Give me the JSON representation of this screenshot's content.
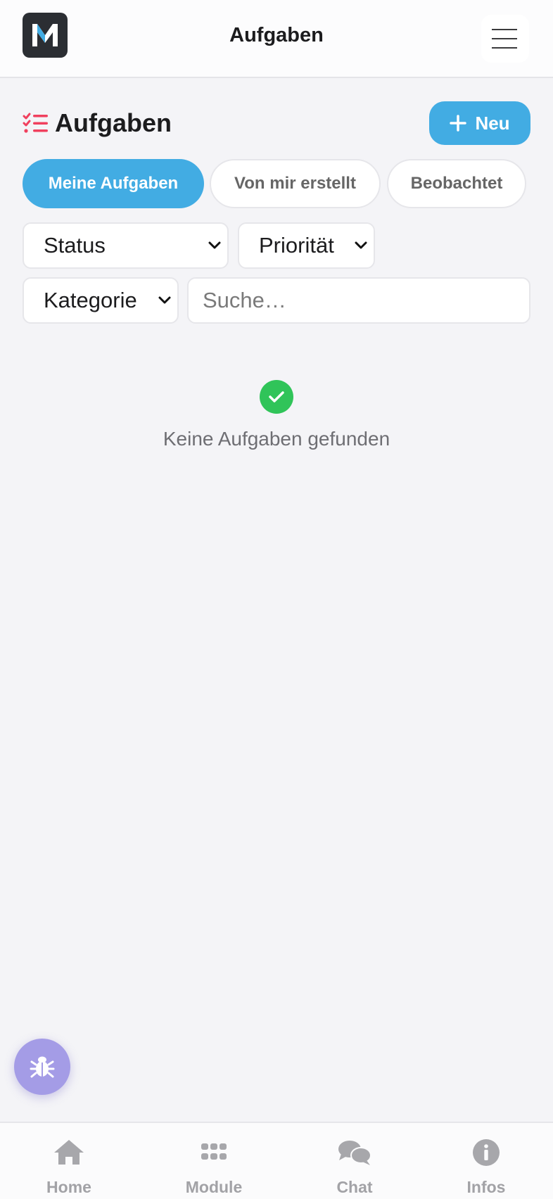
{
  "header": {
    "title": "Aufgaben",
    "logo_letter": "M"
  },
  "page": {
    "title": "Aufgaben",
    "new_button_label": "Neu",
    "accent_color": "#42ace3",
    "title_icon_color": "#f0405e"
  },
  "tabs": [
    {
      "label": "Meine Aufgaben",
      "active": true
    },
    {
      "label": "Von mir erstellt",
      "active": false
    },
    {
      "label": "Beobachtet",
      "active": false
    }
  ],
  "filters": {
    "status": "Status",
    "priority": "Priorität",
    "category": "Kategorie",
    "search_placeholder": "Suche…"
  },
  "empty_state": {
    "icon": "check-circle-icon",
    "text": "Keine Aufgaben gefunden",
    "color": "#30c459"
  },
  "fab": {
    "icon": "bug-icon",
    "color": "#a49ce6"
  },
  "bottom_nav": [
    {
      "label": "Home",
      "icon": "home-icon"
    },
    {
      "label": "Module",
      "icon": "grid-icon"
    },
    {
      "label": "Chat",
      "icon": "chat-icon"
    },
    {
      "label": "Infos",
      "icon": "info-icon"
    }
  ]
}
